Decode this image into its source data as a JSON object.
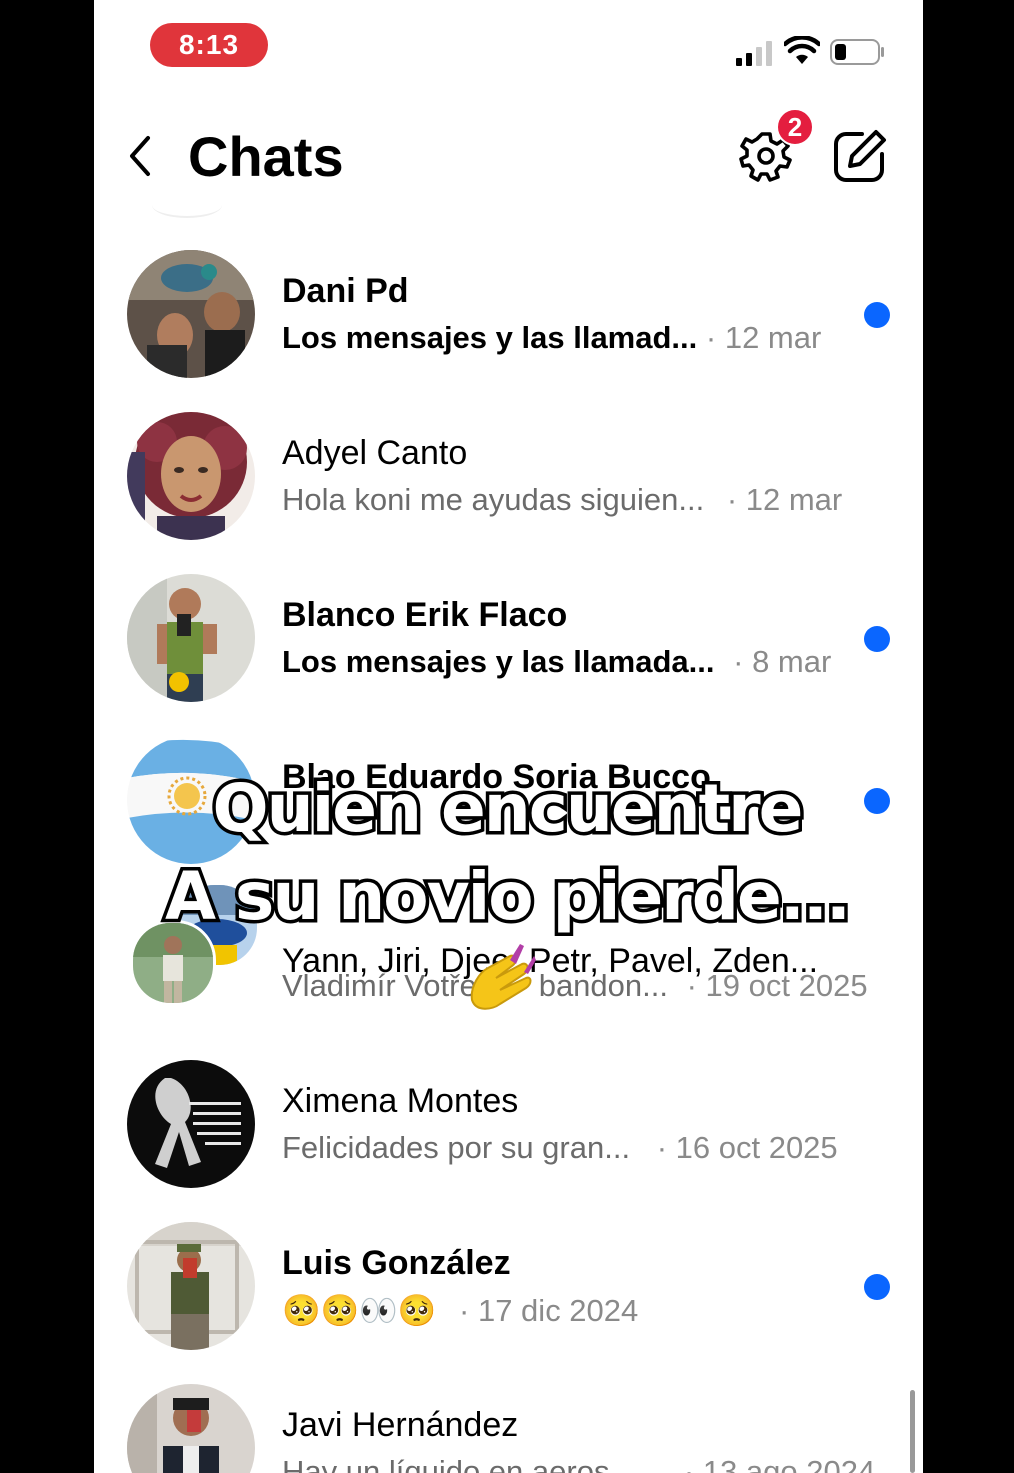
{
  "status_bar": {
    "time": "8:13"
  },
  "header": {
    "title": "Chats",
    "settings_badge": "2"
  },
  "chats": [
    {
      "name": "Dani Pd",
      "preview": "Los mensajes y las llamad...",
      "date": "· 12 mar",
      "unread": true
    },
    {
      "name": "Adyel Canto",
      "preview": "Hola koni me ayudas siguien...",
      "date": "· 12 mar",
      "unread": false
    },
    {
      "name": "Blanco Erik Flaco",
      "preview": "Los mensajes y las llamada...",
      "date": "· 8 mar",
      "unread": true
    },
    {
      "name": "Blao Eduardo Soria Bucco",
      "preview": "",
      "date": "",
      "unread": true
    },
    {
      "name": "Yann, Jiri, Djee, Petr, Pavel, Zden...",
      "preview": "Vladimír Votře",
      "preview_tail": "bandon...",
      "date": "· 19 oct 2025",
      "unread": false
    },
    {
      "name": "Ximena Montes",
      "preview": "Felicidades por su gran...",
      "date": "· 16 oct 2025",
      "unread": false
    },
    {
      "name": "Luis González",
      "preview": "🥺🥺👀🥺",
      "date": "· 17 dic 2024",
      "unread": true
    },
    {
      "name": "Javi Hernández",
      "preview": "Hay un líquido en aeros...",
      "date": "· 13 ago 2024",
      "unread": false
    }
  ],
  "overlay": {
    "line1": "Quien encuentre",
    "line2": "A su novio pierde..."
  },
  "colors": {
    "unread_dot": "#0a66ff",
    "badge": "#e41e3f",
    "time_pill": "#e0353b"
  }
}
